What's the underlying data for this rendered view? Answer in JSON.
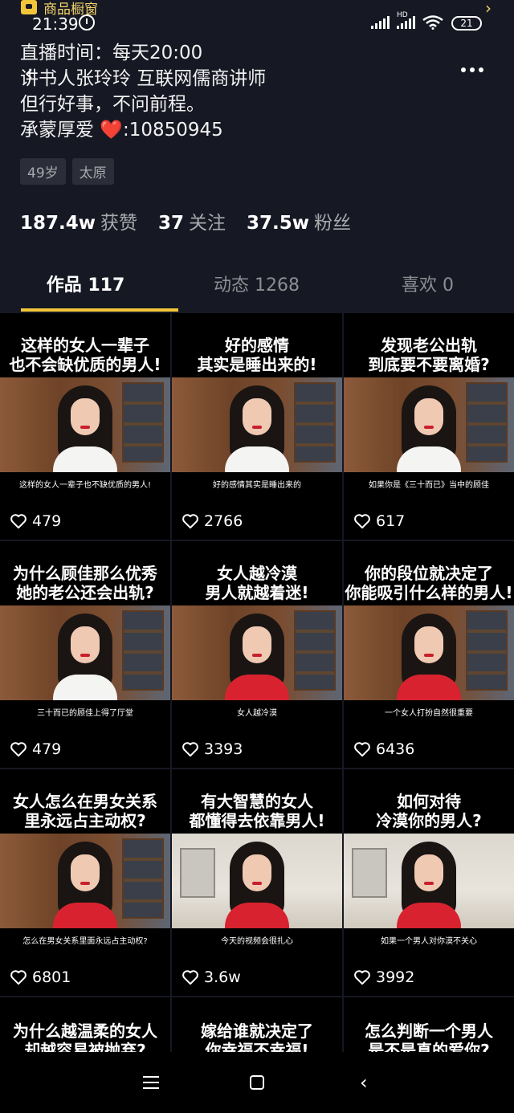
{
  "status_bar": {
    "shop_label": "商品橱窗",
    "time": "21:39",
    "battery": "21",
    "network": "HD"
  },
  "bio": {
    "line1": "直播时间：每天20:00",
    "line2": "讲书人张玲玲 互联网儒商讲师",
    "line3": "但行好事，不问前程。",
    "line4_prefix": "承蒙厚爱 ",
    "line4_heart": "❤️",
    "line4_suffix": ":10850945"
  },
  "tags": [
    "49岁",
    "太原"
  ],
  "stats": [
    {
      "value": "187.4w",
      "label": "获赞"
    },
    {
      "value": "37",
      "label": "关注"
    },
    {
      "value": "37.5w",
      "label": "粉丝"
    }
  ],
  "tabs": [
    {
      "label": "作品 117",
      "active": true
    },
    {
      "label": "动态 1268",
      "active": false
    },
    {
      "label": "喜欢 0",
      "active": false
    }
  ],
  "videos": [
    {
      "caption": "这样的女人一辈子\n也不会缺优质的男人!",
      "subtitle": "这样的女人一辈子也不缺优质的男人!",
      "likes": "479",
      "scene": "office",
      "outfit": "white"
    },
    {
      "caption": "好的感情\n其实是睡出来的!",
      "subtitle": "好的感情其实是睡出来的",
      "likes": "2766",
      "scene": "office",
      "outfit": "white"
    },
    {
      "caption": "发现老公出轨\n到底要不要离婚?",
      "subtitle": "如果你是《三十而已》当中的顾佳",
      "likes": "617",
      "scene": "office",
      "outfit": "white"
    },
    {
      "caption": "为什么顾佳那么优秀\n她的老公还会出轨?",
      "subtitle": "三十而已的顾佳上得了厅堂",
      "likes": "479",
      "scene": "office",
      "outfit": "white"
    },
    {
      "caption": "女人越冷漠\n男人就越着迷!",
      "subtitle": "女人越冷漠",
      "likes": "3393",
      "scene": "office",
      "outfit": "red"
    },
    {
      "caption": "你的段位就决定了\n你能吸引什么样的男人!",
      "subtitle": "一个女人打扮自然很重要",
      "likes": "6436",
      "scene": "office",
      "outfit": "red"
    },
    {
      "caption": "女人怎么在男女关系\n里永远占主动权?",
      "subtitle": "怎么在男女关系里面永远占主动权?",
      "likes": "6801",
      "scene": "office",
      "outfit": "red"
    },
    {
      "caption": "有大智慧的女人\n都懂得去依靠男人!",
      "subtitle": "今天的视频会很扎心",
      "likes": "3.6w",
      "scene": "bright",
      "outfit": "red"
    },
    {
      "caption": "如何对待\n冷漠你的男人?",
      "subtitle": "如果一个男人对你漠不关心",
      "likes": "3992",
      "scene": "bright",
      "outfit": "red"
    }
  ],
  "partial_videos": [
    {
      "caption": "为什么越温柔的女人\n却越容易被抛弃?"
    },
    {
      "caption": "嫁给谁就决定了\n你幸福不幸福!"
    },
    {
      "caption": "怎么判断一个男人\n是不是真的爱你?"
    }
  ],
  "icons": {
    "back": "chevron-left-icon",
    "more": "more-dots-icon",
    "like": "heart-outline-icon"
  },
  "colors": {
    "background": "#161823",
    "accent": "#f3c63a"
  }
}
